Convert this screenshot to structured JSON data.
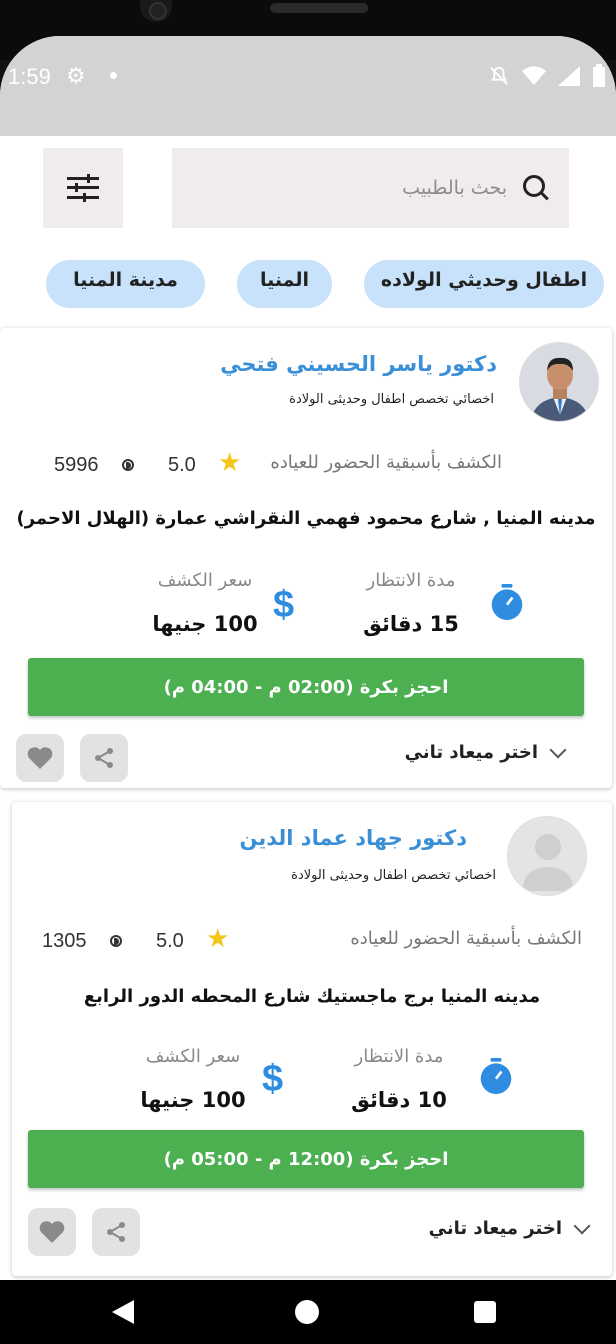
{
  "status_bar": {
    "time": "1:59",
    "icons": [
      "gear-icon",
      "notification-dot",
      "mute-icon",
      "wifi-icon",
      "signal-icon",
      "battery-icon"
    ]
  },
  "search": {
    "placeholder": "بحث بالطبيب"
  },
  "chips": [
    {
      "label": "اطفال وحديثي الولاده"
    },
    {
      "label": "المنيا"
    },
    {
      "label": "مدينة المنيا"
    }
  ],
  "doctors": [
    {
      "name": "دكتور ياسر الحسيني فتحي",
      "specialty": "اخصائي تخصص اطفال وحديثى الولادة",
      "booking_type": "الكشف بأسبقية الحضور للعياده",
      "rating": "5.0",
      "views": "5996",
      "address": "مدينه المنيا , شارع محمود فهمي النقراشي  عمارة (الهلال الاحمر)",
      "wait_label": "مدة الانتظار",
      "wait_value": "15 دقائق",
      "price_label": "سعر الكشف",
      "price_value": "100 جنيها",
      "book_label": "احجز بكرة (02:00 م - 04:00 م)",
      "other_slot_label": "اختر ميعاد تاني",
      "has_photo": true
    },
    {
      "name": "دكتور جهاد عماد الدين",
      "specialty": "اخصائي تخصص اطفال وحديثى الولادة",
      "booking_type": "الكشف بأسبقية الحضور للعياده",
      "rating": "5.0",
      "views": "1305",
      "address": "مدينه المنيا برج ماجستيك شارع المحطه الدور الرابع",
      "wait_label": "مدة الانتظار",
      "wait_value": "10 دقائق",
      "price_label": "سعر الكشف",
      "price_value": "100 جنيها",
      "book_label": "احجز بكرة (12:00 م - 05:00 م)",
      "other_slot_label": "اختر ميعاد تاني",
      "has_photo": false
    }
  ],
  "colors": {
    "accent_blue": "#3a8fd6",
    "book_green": "#4caf50",
    "chip_bg": "#c8e2fb",
    "star": "#f5c518"
  }
}
